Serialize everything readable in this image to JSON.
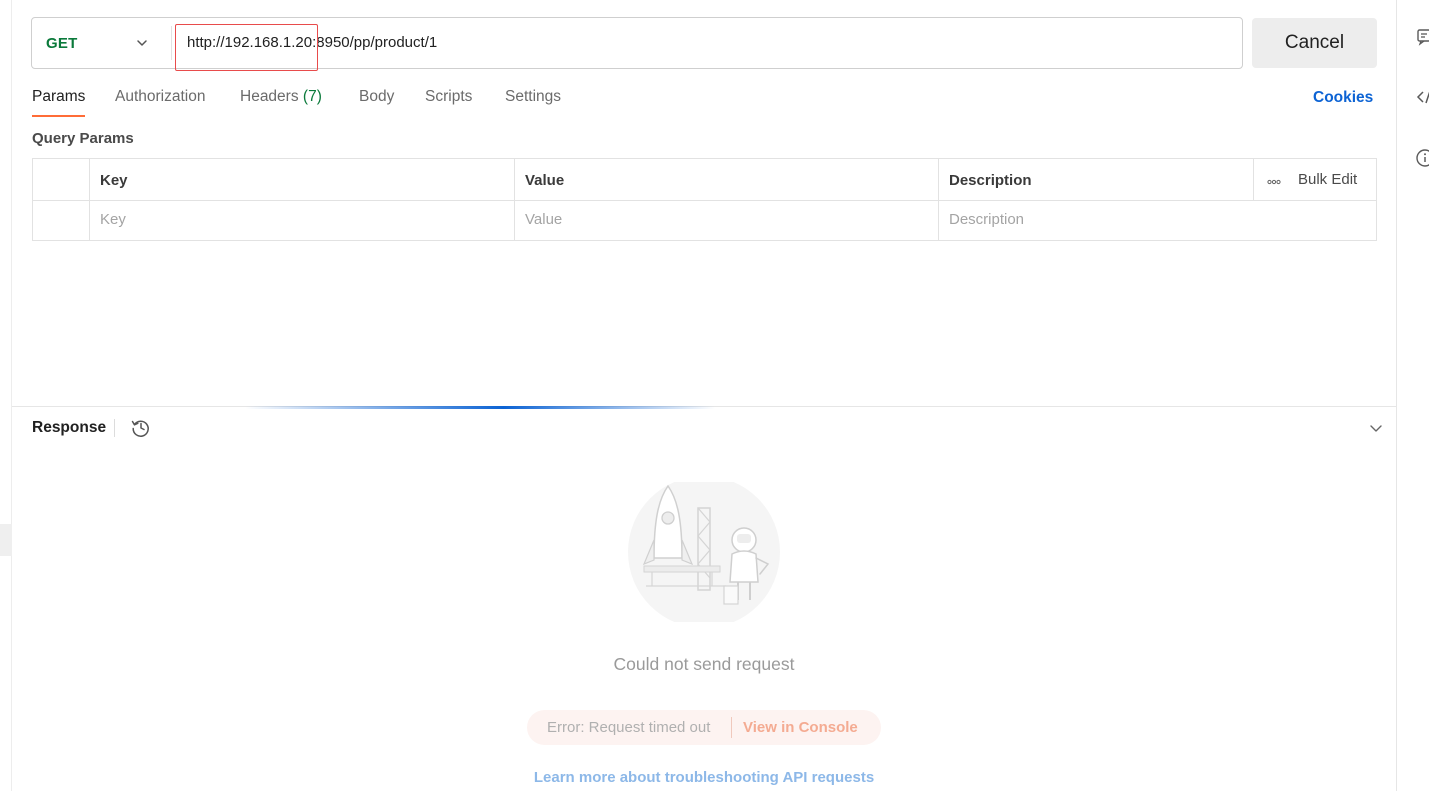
{
  "request": {
    "method": "GET",
    "url": "http://192.168.1.20:8950/pp/product/1",
    "cancel_label": "Cancel"
  },
  "tabs": {
    "params": "Params",
    "authorization": "Authorization",
    "headers": "Headers",
    "headers_count": "(7)",
    "body": "Body",
    "scripts": "Scripts",
    "settings": "Settings",
    "active": "Params"
  },
  "cookies_label": "Cookies",
  "query_params": {
    "title": "Query Params",
    "columns": [
      "Key",
      "Value",
      "Description"
    ],
    "placeholders": [
      "Key",
      "Value",
      "Description"
    ],
    "bulk_edit_label": "Bulk Edit"
  },
  "response": {
    "title": "Response",
    "empty_message": "Could not send request",
    "error_text": "Error: Request timed out",
    "console_link": "View in Console",
    "learn_more": "Learn more about troubleshooting API requests"
  },
  "colors": {
    "accent": "#ff6c37",
    "get_method": "#0b7a3b",
    "link": "#0c63d4",
    "highlight": "#e84b4b"
  },
  "icons": {
    "method_dropdown": "chevron-down-icon",
    "bulk_more": "more-horizontal-icon",
    "history": "history-icon",
    "collapse": "chevron-down-icon",
    "rail": [
      "comments-icon",
      "code-icon",
      "info-icon"
    ]
  }
}
